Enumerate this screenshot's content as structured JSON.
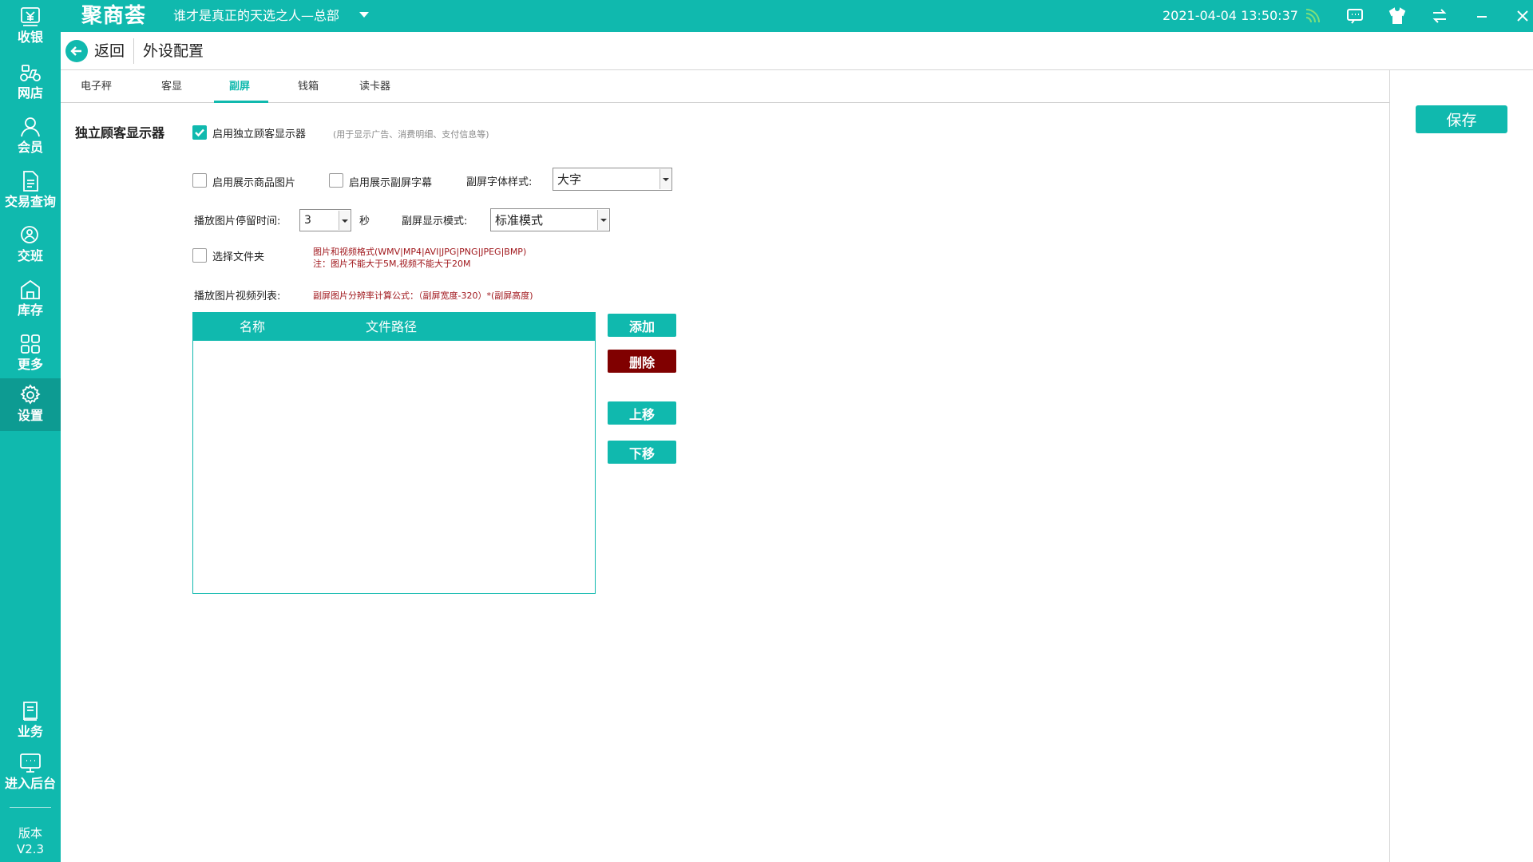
{
  "sidebar": {
    "items": [
      {
        "label": "收银",
        "icon": "cash-register-icon"
      },
      {
        "label": "网店",
        "icon": "delivery-bike-icon"
      },
      {
        "label": "会员",
        "icon": "member-icon"
      },
      {
        "label": "交易查询",
        "icon": "document-icon"
      },
      {
        "label": "交班",
        "icon": "handover-icon"
      },
      {
        "label": "库存",
        "icon": "warehouse-icon"
      },
      {
        "label": "更多",
        "icon": "grid-icon"
      },
      {
        "label": "设置",
        "icon": "gear-icon",
        "active": true
      },
      {
        "label": "业务",
        "icon": "business-book-icon"
      },
      {
        "label": "进入后台",
        "icon": "monitor-icon"
      }
    ],
    "version_label": "版本",
    "version_value": "V2.3"
  },
  "topbar": {
    "logo": "聚商荟",
    "store": "谁才是真正的天选之人—总部",
    "datetime": "2021-04-04 13:50:37"
  },
  "header": {
    "back_label": "返回",
    "page_title": "外设配置"
  },
  "tabs": [
    "电子秤",
    "客显",
    "副屏",
    "钱箱",
    "读卡器"
  ],
  "active_tab": "副屏",
  "save_label": "保存",
  "section": {
    "title": "独立顾客显示器",
    "enable_label": "启用独立顾客显示器",
    "enable_hint": "(用于显示广告、消费明细、支付信息等)",
    "show_goods_img_label": "启用展示商品图片",
    "show_subtitle_label": "启用展示副屏字幕",
    "font_style_label": "副屏字体样式:",
    "font_style_value": "大字",
    "dwell_label": "播放图片停留时间:",
    "dwell_value": "3",
    "dwell_unit": "秒",
    "display_mode_label": "副屏显示模式:",
    "display_mode_value": "标准模式",
    "folder_label": "选择文件夹",
    "format_note_1": "图片和视频格式(WMV|MP4|AVI|JPG|PNG|JPEG|BMP)",
    "format_note_2": "注：图片不能大于5M,视频不能大于20M",
    "list_label": "播放图片视频列表:",
    "formula_note": "副屏图片分辨率计算公式：（副屏宽度-320）*(副屏高度)"
  },
  "table": {
    "columns": [
      "名称",
      "文件路径"
    ],
    "rows": []
  },
  "actions": {
    "add": "添加",
    "delete": "删除",
    "up": "上移",
    "down": "下移"
  },
  "colors": {
    "primary": "#10b9ae",
    "danger": "#800000",
    "note": "#a0171c"
  }
}
